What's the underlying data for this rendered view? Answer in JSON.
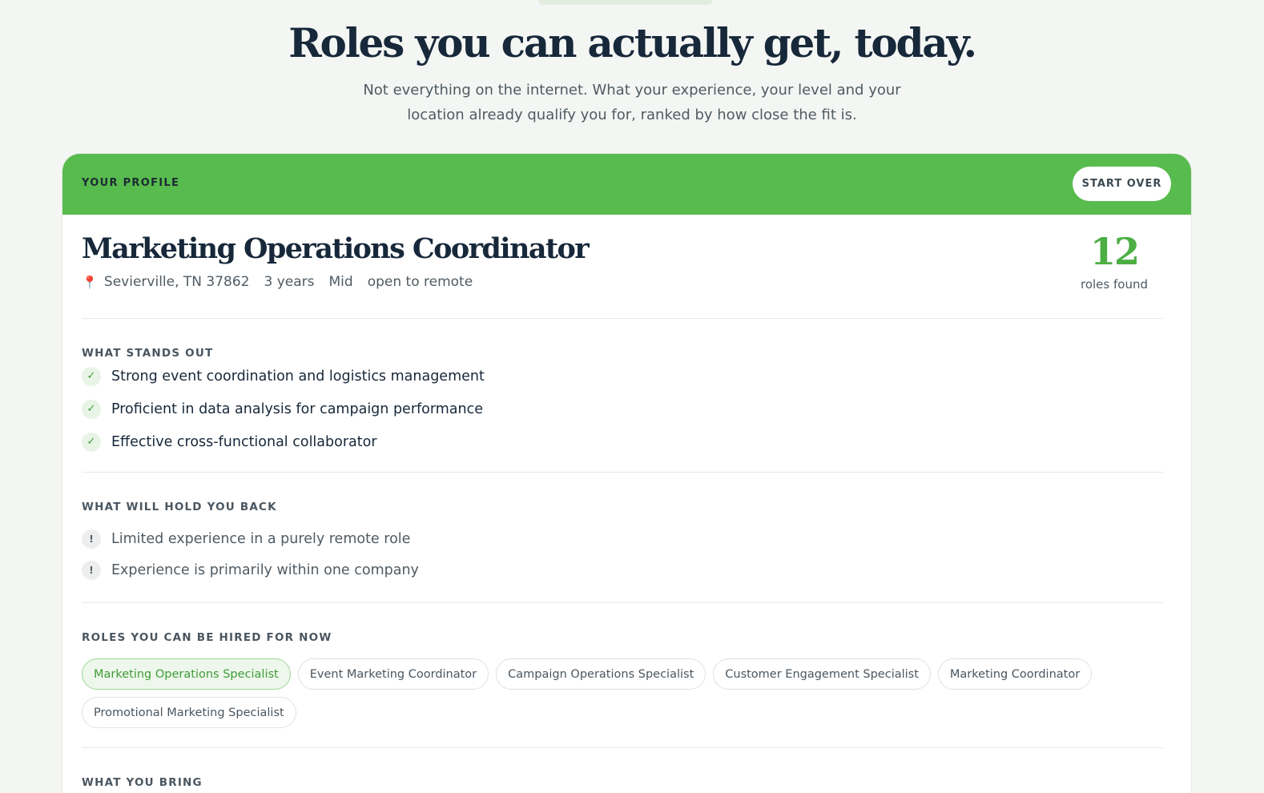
{
  "hero": {
    "title": "Roles you can actually get, today.",
    "subtitle_line1": "Not everything on the internet. What your experience, your level and your",
    "subtitle_line2": "location already qualify you for, ranked by how close the fit is."
  },
  "profile_card": {
    "header_label": "YOUR PROFILE",
    "start_over_label": "START OVER",
    "title": "Marketing Operations Coordinator",
    "location_icon": "map-pin-icon",
    "location": "Sevierville, TN 37862",
    "experience": "3 years",
    "level": "Mid",
    "remote": "open to remote",
    "roles_count": "12",
    "roles_count_label": "roles found"
  },
  "strengths": {
    "label": "WHAT STANDS OUT",
    "icon": "check-icon",
    "items": [
      "Strong event coordination and logistics management",
      "Proficient in data analysis for campaign performance",
      "Effective cross-functional collaborator"
    ]
  },
  "weaknesses": {
    "label": "WHAT WILL HOLD YOU BACK",
    "icon": "exclamation-icon",
    "items": [
      "Limited experience in a purely remote role",
      "Experience is primarily within one company"
    ]
  },
  "roles": {
    "label": "ROLES YOU CAN BE HIRED FOR NOW",
    "items": [
      "Marketing Operations Specialist",
      "Event Marketing Coordinator",
      "Campaign Operations Specialist",
      "Customer Engagement Specialist",
      "Marketing Coordinator",
      "Promotional Marketing Specialist"
    ],
    "selected": "Marketing Operations Specialist"
  },
  "bring": {
    "label": "WHAT YOU BRING"
  },
  "colors": {
    "accent_green": "#58bb4e",
    "count_green": "#4cae43",
    "heading_navy": "#17283a"
  }
}
